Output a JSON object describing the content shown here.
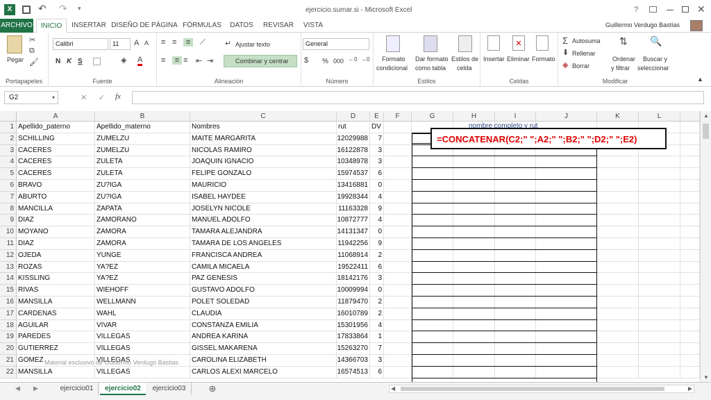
{
  "title": {
    "window_title": "ejercicio.sumar.si - Microsoft Excel",
    "help": "?",
    "user": "Guillermo Verdugo Bastías"
  },
  "tabs": [
    "ARCHIVO",
    "INICIO",
    "INSERTAR",
    "DISEÑO DE PÁGINA",
    "FÓRMULAS",
    "DATOS",
    "REVISAR",
    "VISTA"
  ],
  "ribbon": {
    "clipboard": {
      "paste": "Pegar",
      "label": "Portapapeles"
    },
    "font": {
      "name": "Calibri",
      "size": "11",
      "bold": "N",
      "italic": "K",
      "underline": "S",
      "label": "Fuente"
    },
    "align": {
      "wrap": "Ajustar texto",
      "merge": "Combinar y centrar",
      "label": "Alineación"
    },
    "number": {
      "format": "General",
      "percent": "%",
      "thousands": "000",
      "label": "Número"
    },
    "styles": {
      "cond1": "Formato",
      "cond2": "condicional",
      "table1": "Dar formato",
      "table2": "como tabla",
      "cell1": "Estilos de",
      "cell2": "celda",
      "label": "Estilos"
    },
    "cells": {
      "insert": "Insertar",
      "delete": "Eliminar",
      "format": "Formato",
      "label": "Celdas"
    },
    "modify": {
      "autosum": "Autosuma",
      "fill": "Rellenar",
      "clear": "Borrar",
      "sort1": "Ordenar",
      "sort2": "y filtrar",
      "find1": "Buscar y",
      "find2": "seleccionar",
      "label": "Modificar"
    }
  },
  "formula_bar": {
    "name_box": "G2",
    "fx": "fx",
    "value": ""
  },
  "columns": [
    "A",
    "B",
    "C",
    "D",
    "E",
    "F",
    "G",
    "H",
    "I",
    "J",
    "K",
    "L"
  ],
  "overlay": {
    "g1_text": "nombre completo y rut",
    "formula": "=CONCATENAR(C2;\" \";A2;\" \";B2;\" \";D2;\" \";E2)"
  },
  "watermark": "Material esclusivo de Guillermo Verdugo Bastias",
  "rows": [
    {
      "n": "1",
      "a": "Apellido_paterno",
      "b": "Apellido_materno",
      "c": "Nombres",
      "d": "rut",
      "e": "DV"
    },
    {
      "n": "2",
      "a": "SCHILLING",
      "b": "ZUMELZU",
      "c": "MAITE MARGARITA",
      "d": "12029988",
      "e": "7"
    },
    {
      "n": "3",
      "a": "CACERES",
      "b": "ZUMELZU",
      "c": "NICOLAS RAMIRO",
      "d": "16122878",
      "e": "3"
    },
    {
      "n": "4",
      "a": "CACERES",
      "b": "ZULETA",
      "c": "JOAQUIN IGNACIO",
      "d": "10348978",
      "e": "3"
    },
    {
      "n": "5",
      "a": "CACERES",
      "b": "ZULETA",
      "c": "FELIPE GONZALO",
      "d": "15974537",
      "e": "6"
    },
    {
      "n": "6",
      "a": "BRAVO",
      "b": "ZU?IGA",
      "c": "MAURICIO",
      "d": "13416881",
      "e": "0"
    },
    {
      "n": "7",
      "a": "ABURTO",
      "b": "ZU?IGA",
      "c": "ISABEL HAYDEE",
      "d": "19928344",
      "e": "4"
    },
    {
      "n": "8",
      "a": "MANCILLA",
      "b": "ZAPATA",
      "c": "JOSELYN NICOLE",
      "d": "11163328",
      "e": "9"
    },
    {
      "n": "9",
      "a": "DIAZ",
      "b": "ZAMORANO",
      "c": "MANUEL ADOLFO",
      "d": "10872777",
      "e": "4"
    },
    {
      "n": "10",
      "a": "MOYANO",
      "b": "ZAMORA",
      "c": "TAMARA ALEJANDRA",
      "d": "14131347",
      "e": "0"
    },
    {
      "n": "11",
      "a": "DIAZ",
      "b": "ZAMORA",
      "c": "TAMARA DE LOS ANGELES",
      "d": "11942256",
      "e": "9"
    },
    {
      "n": "12",
      "a": "OJEDA",
      "b": "YUNGE",
      "c": "FRANCISCA ANDREA",
      "d": "11068914",
      "e": "2"
    },
    {
      "n": "13",
      "a": "ROZAS",
      "b": "YA?EZ",
      "c": "CAMILA MICAELA",
      "d": "19522411",
      "e": "6"
    },
    {
      "n": "14",
      "a": "KISSLING",
      "b": "YA?EZ",
      "c": "PAZ GENESIS",
      "d": "18142176",
      "e": "3"
    },
    {
      "n": "15",
      "a": "RIVAS",
      "b": "WIEHOFF",
      "c": "GUSTAVO ADOLFO",
      "d": "10009994",
      "e": "0"
    },
    {
      "n": "16",
      "a": "MANSILLA",
      "b": "WELLMANN",
      "c": "POLET SOLEDAD",
      "d": "11879470",
      "e": "2"
    },
    {
      "n": "17",
      "a": "CARDENAS",
      "b": "WAHL",
      "c": "CLAUDIA",
      "d": "16010789",
      "e": "2"
    },
    {
      "n": "18",
      "a": "AGUILAR",
      "b": "VIVAR",
      "c": "CONSTANZA EMILIA",
      "d": "15301956",
      "e": "4"
    },
    {
      "n": "19",
      "a": "PAREDES",
      "b": "VILLEGAS",
      "c": "ANDREA KARINA",
      "d": "17833864",
      "e": "1"
    },
    {
      "n": "20",
      "a": "GUTIERREZ",
      "b": "VILLEGAS",
      "c": "GISSEL MAKARENA",
      "d": "15263270",
      "e": "7"
    },
    {
      "n": "21",
      "a": "GOMEZ",
      "b": "VILLEGAS",
      "c": "CAROLINA ELIZABETH",
      "d": "14366703",
      "e": "3"
    },
    {
      "n": "22",
      "a": "MANSILLA",
      "b": "VILLEGAS",
      "c": "CARLOS ALEXI MARCELO",
      "d": "16574513",
      "e": "6"
    }
  ],
  "sheets": [
    "ejercicio01",
    "ejercicio02",
    "ejercicio03"
  ],
  "add_sheet": "⊕",
  "colors": {
    "excel_green": "#217346",
    "formula_red": "#e00000"
  }
}
